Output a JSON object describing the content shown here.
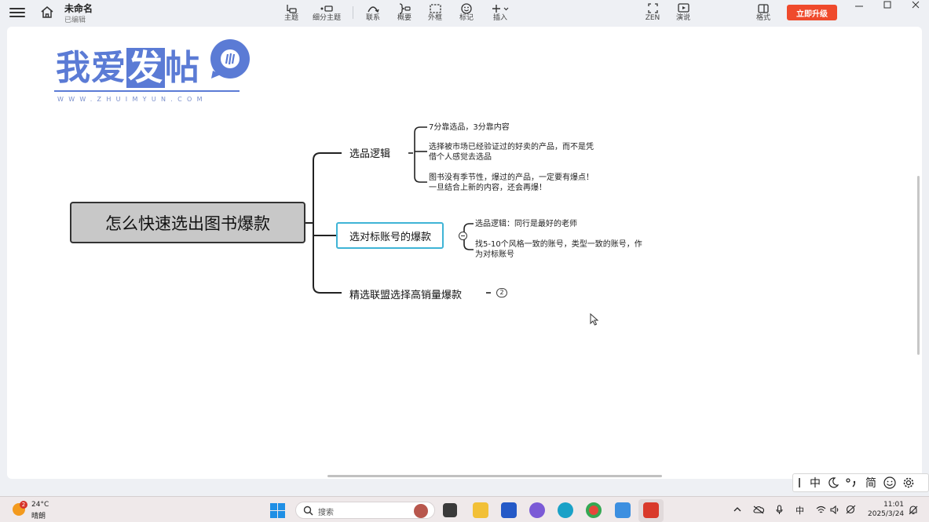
{
  "header": {
    "doc_title": "未命名",
    "doc_status": "已编辑",
    "tools": [
      {
        "label": "主题"
      },
      {
        "label": "细分主题"
      },
      {
        "label": "联系"
      },
      {
        "label": "概要"
      },
      {
        "label": "外框"
      },
      {
        "label": "标记"
      },
      {
        "label": "插入"
      },
      {
        "label": "ZEN"
      },
      {
        "label": "演说"
      },
      {
        "label": "格式"
      }
    ],
    "upgrade_label": "立即升级"
  },
  "logo": {
    "text_a": "我爱",
    "text_b": "发",
    "text_c": "帖",
    "url": "WWW.ZHUIMYUN.COM"
  },
  "mindmap": {
    "root": "怎么快速选出图书爆款",
    "branches": [
      {
        "label": "选品逻辑",
        "leaves": [
          [
            "7分靠选品，3分靠内容"
          ],
          [
            "选择被市场已经验证过的好卖的产品，而不是凭",
            "借个人感觉去选品"
          ],
          [
            "图书没有季节性，爆过的产品，一定要有爆点！",
            "一旦结合上新的内容，还会再爆！"
          ]
        ]
      },
      {
        "label": "选对标账号的爆款",
        "leaves": [
          [
            "选品逻辑：同行是最好的老师"
          ],
          [
            "找5-10个风格一致的账号，类型一致的账号，作",
            "为对标账号"
          ]
        ]
      },
      {
        "label": "精选联盟选择高销量爆款",
        "collapsed_count": "2"
      }
    ]
  },
  "ime": [
    "中",
    "简"
  ],
  "taskbar": {
    "weather_badge": "2",
    "temperature": "24°C",
    "weather": "晴朗",
    "search_placeholder": "搜索",
    "tray_lang": "中",
    "time": "11:01",
    "date": "2025/3/24"
  },
  "colors": {
    "upgrade": "#ef4a2c",
    "selected_border": "#3fb4d6",
    "logo": "#5b7bd5",
    "root_fill": "#c8c8c8"
  }
}
